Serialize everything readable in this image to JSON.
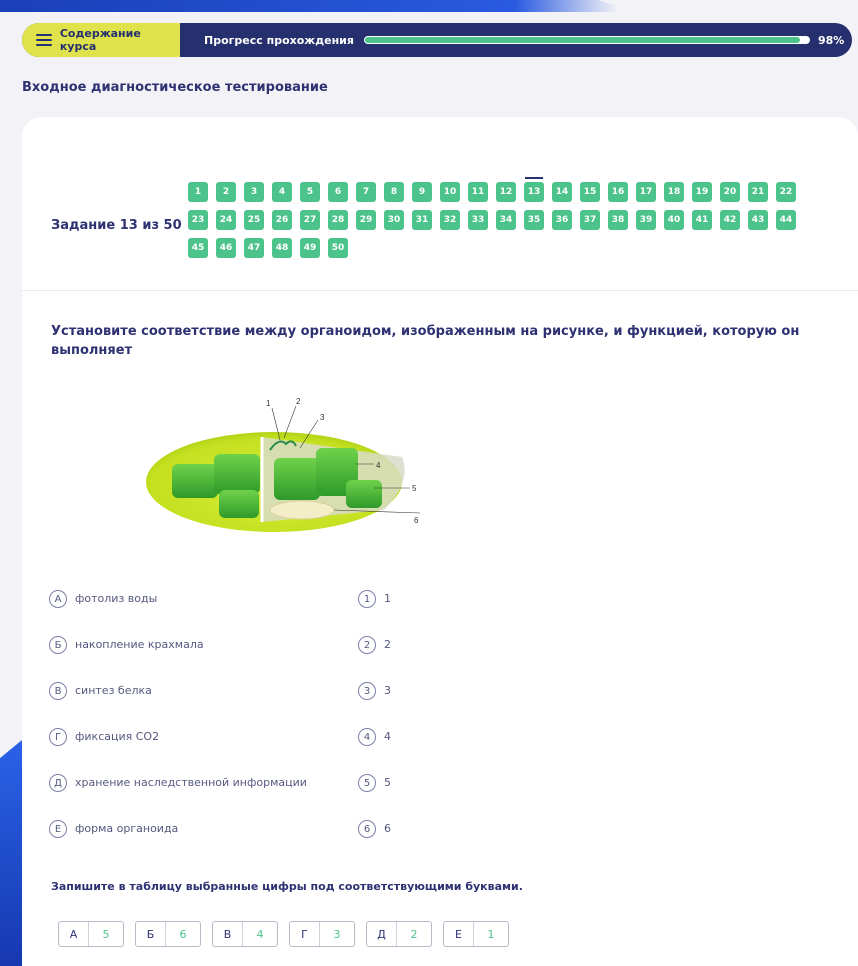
{
  "topbar": {
    "toc_label": "Содержание курса",
    "progress_label": "Прогресс прохождения",
    "progress_value": 98,
    "progress_text": "98%"
  },
  "page_title": "Входное диагностическое тестирование",
  "task": {
    "label": "Задание 13 из 50",
    "current": 13,
    "total": 50,
    "nav": [
      "1",
      "2",
      "3",
      "4",
      "5",
      "6",
      "7",
      "8",
      "9",
      "10",
      "11",
      "12",
      "13",
      "14",
      "15",
      "16",
      "17",
      "18",
      "19",
      "20",
      "21",
      "22",
      "23",
      "24",
      "25",
      "26",
      "27",
      "28",
      "29",
      "30",
      "31",
      "32",
      "33",
      "34",
      "35",
      "36",
      "37",
      "38",
      "39",
      "40",
      "41",
      "42",
      "43",
      "44",
      "45",
      "46",
      "47",
      "48",
      "49",
      "50"
    ]
  },
  "question": "Установите соответствие между органоидом, изображенным на рисунке, и функцией, которую он выполняет",
  "figure_labels": [
    "1",
    "2",
    "3",
    "4",
    "5",
    "6"
  ],
  "left_items": [
    {
      "letter": "А",
      "text": "фотолиз воды"
    },
    {
      "letter": "Б",
      "text": "накопление крахмала"
    },
    {
      "letter": "В",
      "text": "синтез белка"
    },
    {
      "letter": "Г",
      "text": "фиксация CO2"
    },
    {
      "letter": "Д",
      "text": "хранение наследственной информации"
    },
    {
      "letter": "Е",
      "text": "форма органоида"
    }
  ],
  "right_items": [
    {
      "num": "1",
      "text": "1"
    },
    {
      "num": "2",
      "text": "2"
    },
    {
      "num": "3",
      "text": "3"
    },
    {
      "num": "4",
      "text": "4"
    },
    {
      "num": "5",
      "text": "5"
    },
    {
      "num": "6",
      "text": "6"
    }
  ],
  "instruction": "Запишите в таблицу выбранные цифры под соответствующими буквами.",
  "answers": [
    {
      "letter": "А",
      "value": "5"
    },
    {
      "letter": "Б",
      "value": "6"
    },
    {
      "letter": "В",
      "value": "4"
    },
    {
      "letter": "Г",
      "value": "3"
    },
    {
      "letter": "Д",
      "value": "2"
    },
    {
      "letter": "Е",
      "value": "1"
    }
  ],
  "colors": {
    "accent_green": "#4cc38a",
    "navy": "#26306e",
    "toc_yellow": "#dfe24b"
  }
}
